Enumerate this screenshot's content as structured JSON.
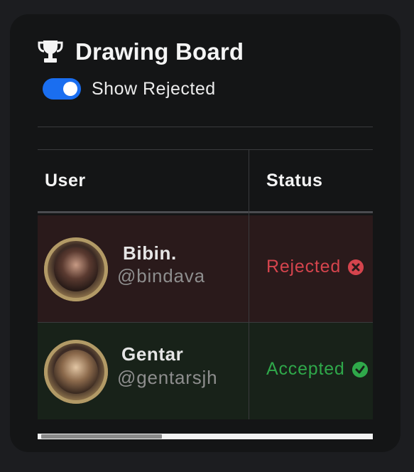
{
  "header": {
    "icon": "trophy-icon",
    "title": "Drawing Board"
  },
  "toggle": {
    "label": "Show Rejected",
    "checked": true,
    "accent": "#1a6ef0"
  },
  "table": {
    "columns": [
      "User",
      "Status"
    ],
    "rows": [
      {
        "name": "Bibin.",
        "handle": "@bindava",
        "status": "Rejected",
        "status_icon": "x-circle-icon",
        "status_color": "#d5444d",
        "row_color": "#2a1a1b"
      },
      {
        "name": "Gentar",
        "handle": "@gentarsjh",
        "status": "Accepted",
        "status_icon": "check-circle-icon",
        "status_color": "#2fa84a",
        "row_color": "#182219"
      }
    ]
  }
}
